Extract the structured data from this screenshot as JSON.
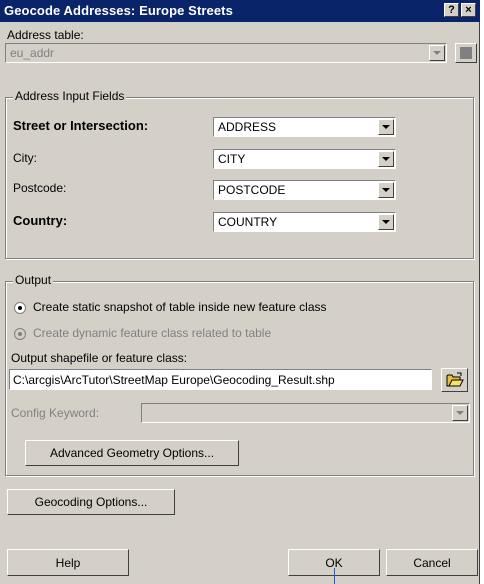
{
  "window": {
    "title": "Geocode Addresses:  Europe Streets",
    "help_btn": "?",
    "close_btn": "×"
  },
  "address_table": {
    "label": "Address table:",
    "value": "eu_addr"
  },
  "address_input": {
    "group_title": "Address Input Fields",
    "fields": [
      {
        "label": "Street or Intersection:",
        "value": "ADDRESS"
      },
      {
        "label": "City:",
        "value": "CITY"
      },
      {
        "label": "Postcode:",
        "value": "POSTCODE"
      },
      {
        "label": "Country:",
        "value": "COUNTRY"
      }
    ]
  },
  "output": {
    "group_title": "Output",
    "radio_static": "Create static snapshot of table inside new feature class",
    "radio_dynamic": "Create dynamic feature class related to table",
    "shapefile_label": "Output shapefile or feature class:",
    "shapefile_value": "C:\\arcgis\\ArcTutor\\StreetMap Europe\\Geocoding_Result.shp",
    "config_keyword_label": "Config Keyword:",
    "advanced_button": "Advanced Geometry Options..."
  },
  "geocoding_options_button": "Geocoding Options...",
  "footer": {
    "help": "Help",
    "ok": "OK",
    "cancel": "Cancel"
  }
}
